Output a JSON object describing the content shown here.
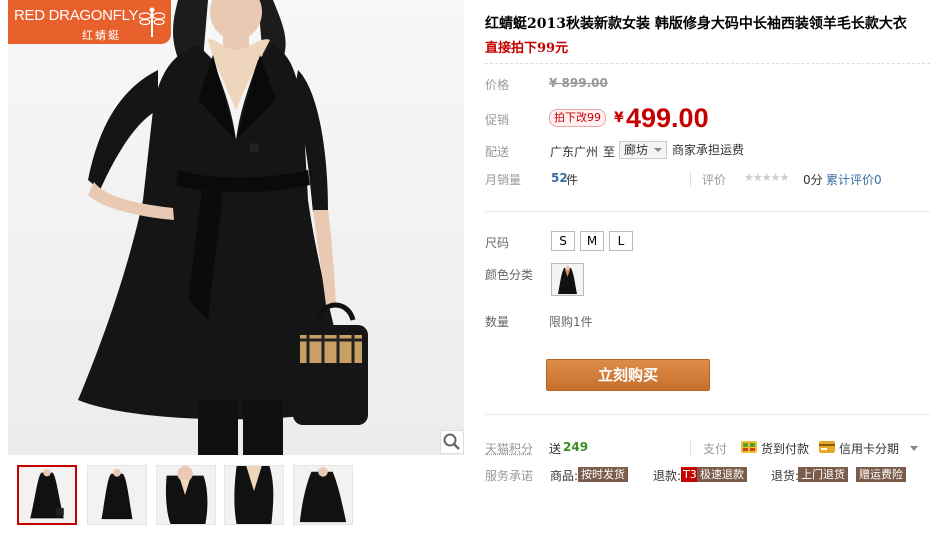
{
  "brand": {
    "name_en": "RED DRAGONFLY",
    "name_cn": "红蜻蜓"
  },
  "product": {
    "title": "红蜻蜓2013秋装新款女装 韩版修身大码中长袖西装领羊毛长款大衣",
    "subtitle": "直接拍下99元"
  },
  "price": {
    "label": "价格",
    "original": "¥ 899.00"
  },
  "promo": {
    "label": "促销",
    "tag": "拍下改99",
    "yen": "¥",
    "price": "499.00"
  },
  "shipping": {
    "label": "配送",
    "from": "广东广州",
    "to_word": "至",
    "destination": "廊坊",
    "fee_note": "商家承担运费"
  },
  "sales": {
    "label": "月销量",
    "count": "52",
    "unit": "件",
    "rating_label": "评价",
    "stars": "★★★★★",
    "score": "0分",
    "total_reviews": "累计评价0"
  },
  "options": {
    "size_label": "尺码",
    "sizes": [
      "S",
      "M",
      "L"
    ],
    "color_label": "颜色分类",
    "quantity_label": "数量",
    "quantity_limit": "限购1件"
  },
  "buy_button": "立刻购买",
  "tmall_points": {
    "label": "天猫积分",
    "prefix": "送",
    "value": "249"
  },
  "payment": {
    "label": "支付",
    "cod": "货到付款",
    "credit": "信用卡分期"
  },
  "service": {
    "label": "服务承诺",
    "goods_label": "商品:",
    "goods_tag": "按时发货",
    "refund_label": "退款:",
    "refund_code": "T3",
    "refund_tag": "极速退款",
    "return_label": "退货:",
    "return_tag": "上门退货",
    "freight_tag": "赠运费险"
  },
  "colors": {
    "accent_red": "#c40000",
    "logo_orange": "#e8602c",
    "buy_orange": "#d07a38",
    "points_green": "#3c8c1e"
  }
}
